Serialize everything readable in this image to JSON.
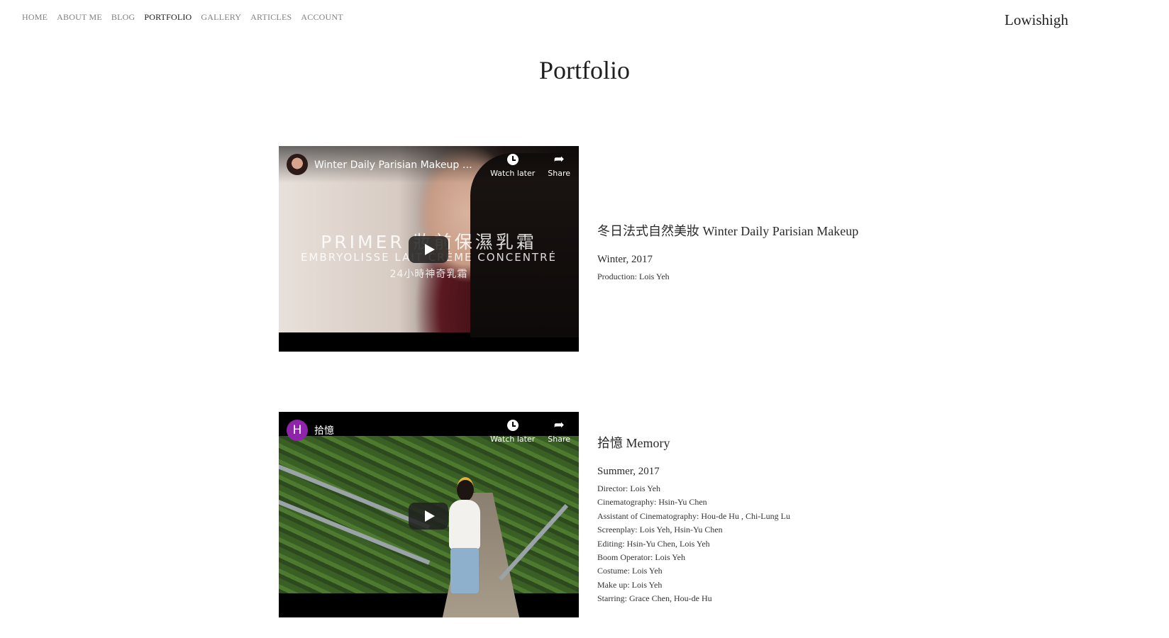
{
  "nav": {
    "items": [
      "HOME",
      "ABOUT ME",
      "BLOG",
      "PORTFOLIO",
      "GALLERY",
      "ARTICLES",
      "ACCOUNT"
    ],
    "active": "PORTFOLIO"
  },
  "brand": "Lowishigh",
  "page_title": "Portfolio",
  "works": [
    {
      "video": {
        "channel_avatar": "",
        "title": "Winter Daily Parisian Makeup 冬日...",
        "watch_later": "Watch later",
        "share": "Share",
        "overlay_lines": [
          "PRIMER 妝前保濕乳霜",
          "EMBRYOLISSE LAIT CRÈME CONCENTRÉ",
          "24小時神奇乳霜"
        ]
      },
      "title": "冬日法式自然美妝 Winter Daily Parisian Makeup",
      "season": "Winter, 2017",
      "credits": [
        "Production: Lois Yeh"
      ]
    },
    {
      "video": {
        "channel_avatar": "H",
        "title": "拾憶",
        "watch_later": "Watch later",
        "share": "Share"
      },
      "title": "拾憶 Memory",
      "season": "Summer, 2017",
      "credits": [
        "Director: Lois Yeh",
        "Cinematography: Hsin-Yu Chen",
        "Assistant of Cinematography: Hou-de Hu , Chi-Lung Lu",
        "Screenplay: Lois Yeh, Hsin-Yu Chen",
        "Editing: Hsin-Yu Chen, Lois Yeh",
        "Boom Operator: Lois Yeh",
        "Costume: Lois Yeh",
        "Make up: Lois Yeh",
        "Starring: Grace Chen, Hou-de Hu"
      ]
    }
  ]
}
